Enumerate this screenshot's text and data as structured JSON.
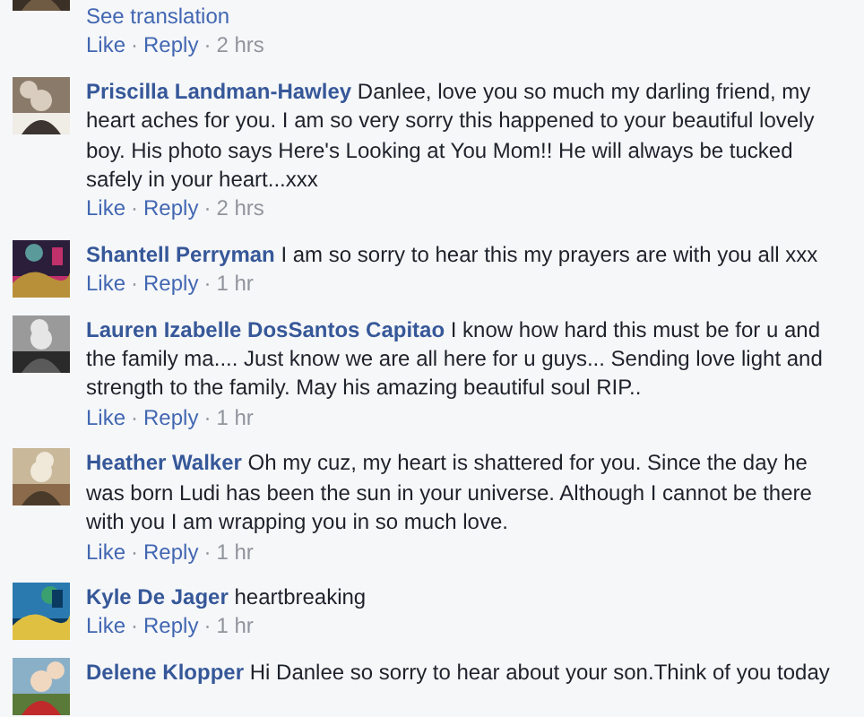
{
  "comments": [
    {
      "kind": "continued",
      "see_translation": "See translation",
      "actions": [
        {
          "kind": "link",
          "label": "Like"
        },
        {
          "kind": "separator",
          "label": "·"
        },
        {
          "kind": "link",
          "label": "Reply"
        },
        {
          "kind": "separator",
          "label": "·"
        },
        {
          "kind": "time",
          "label": "2 hrs"
        }
      ]
    },
    {
      "kind": "full",
      "author": "Priscilla Landman-Hawley",
      "text": "Danlee, love you so much my darling friend, my heart aches for you. I am so very sorry this happened to your beautiful lovely boy. His photo says Here's Looking at You Mom!! He will always be tucked safely in your heart...xxx",
      "actions": [
        {
          "kind": "link",
          "label": "Like"
        },
        {
          "kind": "separator",
          "label": "·"
        },
        {
          "kind": "link",
          "label": "Reply"
        },
        {
          "kind": "separator",
          "label": "·"
        },
        {
          "kind": "time",
          "label": "2 hrs"
        }
      ]
    },
    {
      "kind": "full",
      "author": "Shantell Perryman",
      "text": "I am so sorry to hear this my prayers are with you all xxx",
      "actions": [
        {
          "kind": "link",
          "label": "Like"
        },
        {
          "kind": "separator",
          "label": "·"
        },
        {
          "kind": "link",
          "label": "Reply"
        },
        {
          "kind": "separator",
          "label": "·"
        },
        {
          "kind": "time",
          "label": "1 hr"
        }
      ]
    },
    {
      "kind": "full",
      "author": "Lauren Izabelle DosSantos Capitao",
      "text": "I know how hard this must be for u and the family ma.... Just know we are all here for u guys... Sending love light and strength to the family. May his amazing beautiful soul RIP..",
      "actions": [
        {
          "kind": "link",
          "label": "Like"
        },
        {
          "kind": "separator",
          "label": "·"
        },
        {
          "kind": "link",
          "label": "Reply"
        },
        {
          "kind": "separator",
          "label": "·"
        },
        {
          "kind": "time",
          "label": "1 hr"
        }
      ]
    },
    {
      "kind": "full",
      "author": "Heather Walker",
      "text": "Oh my cuz, my heart is shattered for you. Since the day he was born Ludi has been the sun in your universe. Although I cannot be there with you I am wrapping you in so much love.",
      "actions": [
        {
          "kind": "link",
          "label": "Like"
        },
        {
          "kind": "separator",
          "label": "·"
        },
        {
          "kind": "link",
          "label": "Reply"
        },
        {
          "kind": "separator",
          "label": "·"
        },
        {
          "kind": "time",
          "label": "1 hr"
        }
      ]
    },
    {
      "kind": "full",
      "author": "Kyle De Jager",
      "text": "heartbreaking",
      "actions": [
        {
          "kind": "link",
          "label": "Like"
        },
        {
          "kind": "separator",
          "label": "·"
        },
        {
          "kind": "link",
          "label": "Reply"
        },
        {
          "kind": "separator",
          "label": "·"
        },
        {
          "kind": "time",
          "label": "1 hr"
        }
      ]
    },
    {
      "kind": "full",
      "author": "Delene Klopper",
      "text": "Hi Danlee so sorry to hear about your son.Think of you today"
    }
  ]
}
